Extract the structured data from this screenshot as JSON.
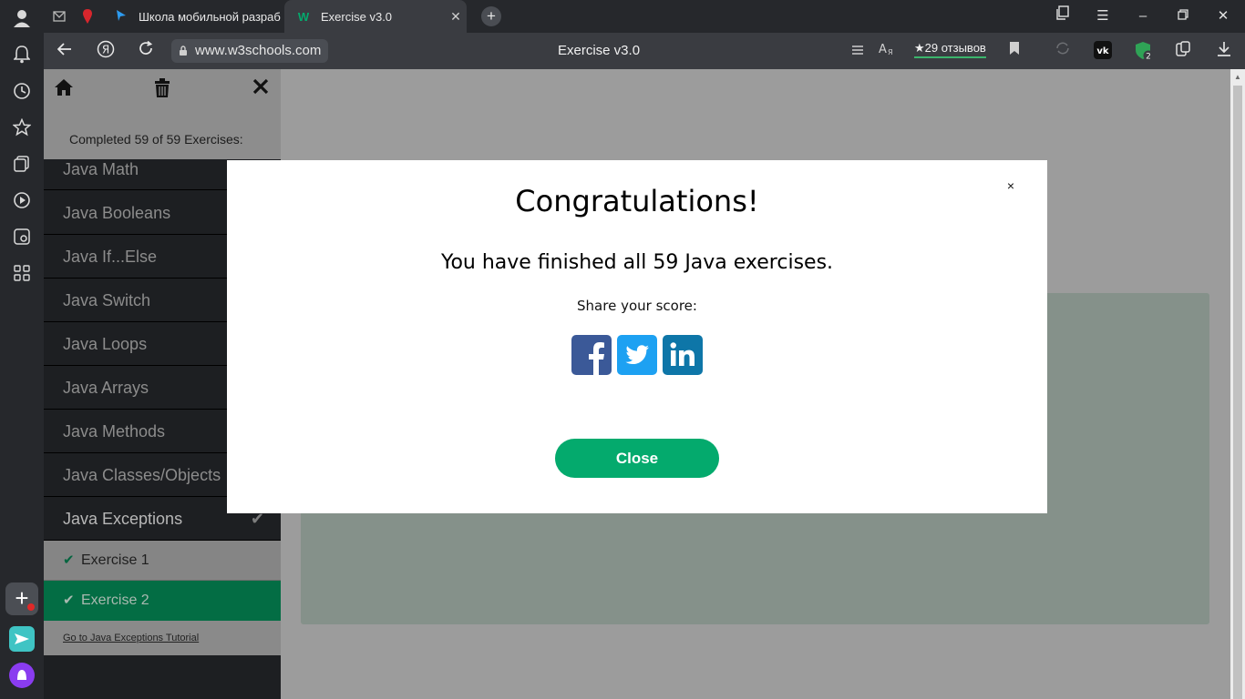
{
  "browser": {
    "tabs": [
      {
        "title": "Школа мобильной разраб",
        "favicon": "arrow-favicon"
      },
      {
        "title": "Exercise v3.0",
        "favicon": "w3schools-favicon",
        "active": true
      }
    ],
    "address": "www.w3schools.com",
    "page_title": "Exercise v3.0",
    "reviews": "★29 отзывов",
    "shield_badge": "2"
  },
  "sidebar": {
    "status": "Completed 59 of 59 Exercises:",
    "menu": [
      "Java Math",
      "Java Booleans",
      "Java If...Else",
      "Java Switch",
      "Java Loops",
      "Java Arrays",
      "Java Methods",
      "Java Classes/Objects",
      "Java Exceptions"
    ],
    "sub_items": [
      "Exercise 1",
      "Exercise 2"
    ],
    "tutorial_link": "Go to Java Exceptions Tutorial"
  },
  "modal": {
    "title": "Congratulations!",
    "message": "You have finished all 59 Java exercises.",
    "share_label": "Share your score:",
    "close_label": "Close",
    "close_x": "×"
  },
  "colors": {
    "accent": "#04aa6d",
    "sub_selected": "#036d44",
    "facebook": "#3b5998",
    "twitter": "#1da1f2",
    "linkedin": "#0e76a8"
  }
}
